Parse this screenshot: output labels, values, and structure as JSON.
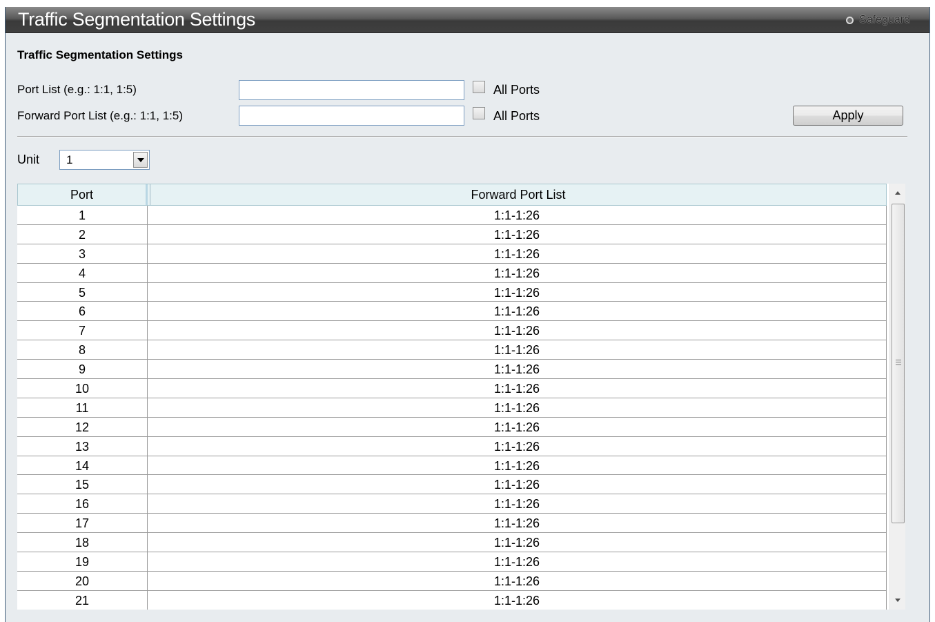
{
  "header": {
    "title": "Traffic Segmentation Settings",
    "safeguard_label": "Safeguard"
  },
  "form": {
    "section_title": "Traffic Segmentation Settings",
    "port_list": {
      "label": "Port List (e.g.: 1:1, 1:5)",
      "value": "",
      "all_ports_label": "All Ports",
      "all_ports_checked": false
    },
    "forward_port_list": {
      "label": "Forward Port List (e.g.: 1:1, 1:5)",
      "value": "",
      "all_ports_label": "All Ports",
      "all_ports_checked": false
    },
    "apply_label": "Apply"
  },
  "unit": {
    "label": "Unit",
    "selected": "1"
  },
  "table": {
    "columns": [
      "Port",
      "Forward Port List"
    ],
    "rows": [
      {
        "port": "1",
        "forward": "1:1-1:26"
      },
      {
        "port": "2",
        "forward": "1:1-1:26"
      },
      {
        "port": "3",
        "forward": "1:1-1:26"
      },
      {
        "port": "4",
        "forward": "1:1-1:26"
      },
      {
        "port": "5",
        "forward": "1:1-1:26"
      },
      {
        "port": "6",
        "forward": "1:1-1:26"
      },
      {
        "port": "7",
        "forward": "1:1-1:26"
      },
      {
        "port": "8",
        "forward": "1:1-1:26"
      },
      {
        "port": "9",
        "forward": "1:1-1:26"
      },
      {
        "port": "10",
        "forward": "1:1-1:26"
      },
      {
        "port": "11",
        "forward": "1:1-1:26"
      },
      {
        "port": "12",
        "forward": "1:1-1:26"
      },
      {
        "port": "13",
        "forward": "1:1-1:26"
      },
      {
        "port": "14",
        "forward": "1:1-1:26"
      },
      {
        "port": "15",
        "forward": "1:1-1:26"
      },
      {
        "port": "16",
        "forward": "1:1-1:26"
      },
      {
        "port": "17",
        "forward": "1:1-1:26"
      },
      {
        "port": "18",
        "forward": "1:1-1:26"
      },
      {
        "port": "19",
        "forward": "1:1-1:26"
      },
      {
        "port": "20",
        "forward": "1:1-1:26"
      },
      {
        "port": "21",
        "forward": "1:1-1:26"
      }
    ]
  },
  "icons": {
    "safeguard": "safeguard-icon",
    "dropdown": "chevron-down-icon",
    "scroll_up": "arrow-up-icon",
    "scroll_down": "arrow-down-icon"
  },
  "colors": {
    "title_bar": "#4a4a4a",
    "panel_background": "#e8ecef",
    "table_header": "#e6f2f4",
    "input_border": "#7a9cc0"
  }
}
